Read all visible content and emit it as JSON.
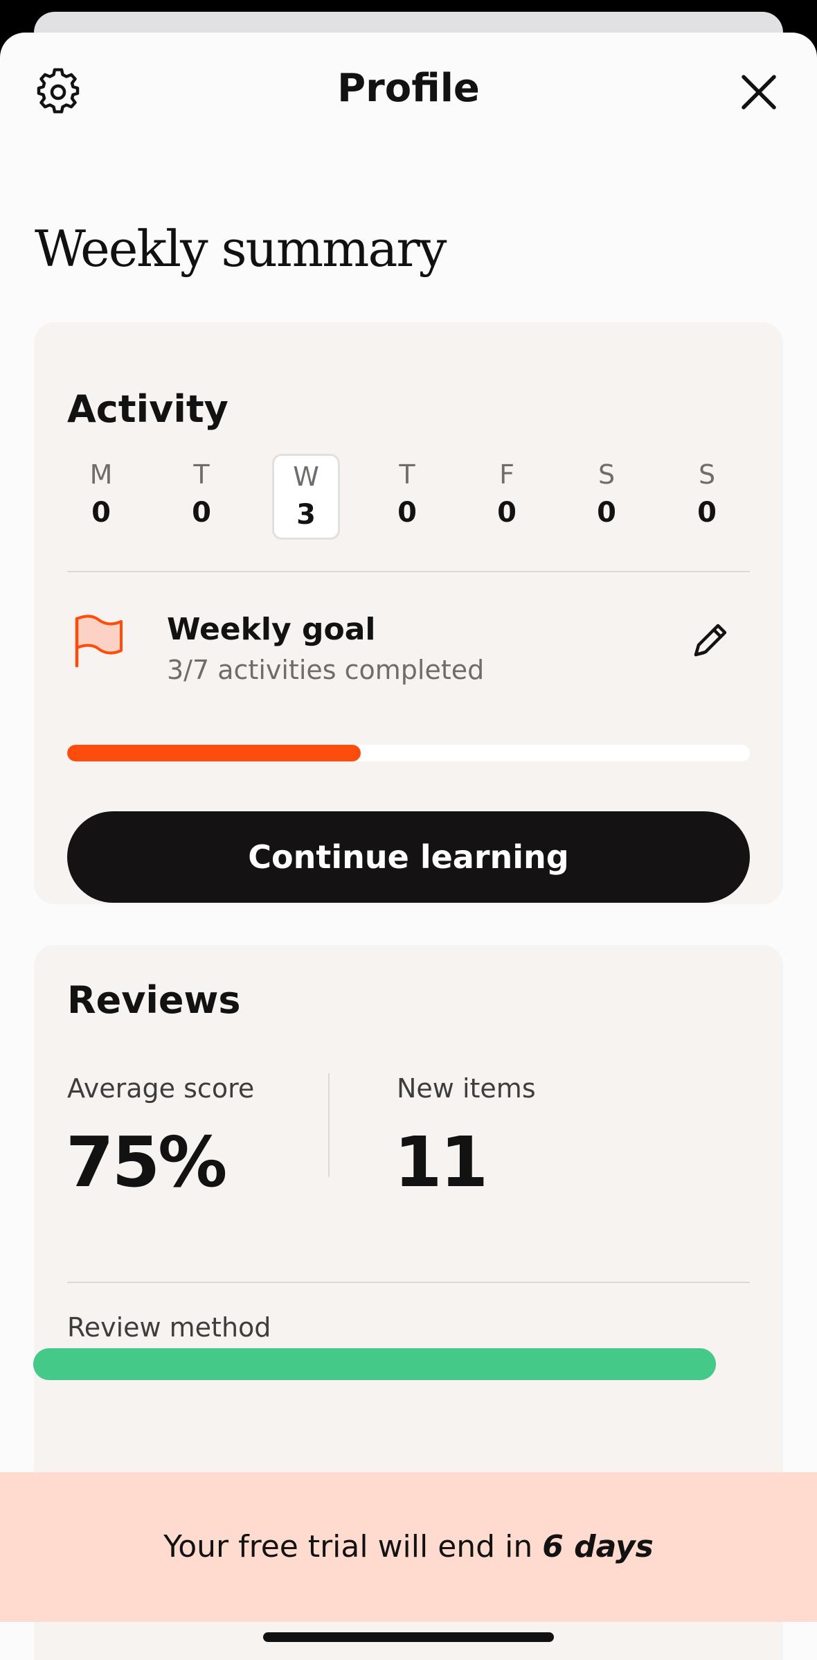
{
  "header": {
    "title": "Profile"
  },
  "weekly": {
    "title": "Weekly summary"
  },
  "activity": {
    "title": "Activity",
    "days": [
      {
        "letter": "M",
        "count": "0"
      },
      {
        "letter": "T",
        "count": "0"
      },
      {
        "letter": "W",
        "count": "3"
      },
      {
        "letter": "T",
        "count": "0"
      },
      {
        "letter": "F",
        "count": "0"
      },
      {
        "letter": "S",
        "count": "0"
      },
      {
        "letter": "S",
        "count": "0"
      }
    ],
    "goal_title": "Weekly goal",
    "goal_subtitle": "3/7 activities completed",
    "goal_progress": 0.43,
    "continue_label": "Continue learning"
  },
  "reviews": {
    "title": "Reviews",
    "average_label": "Average score",
    "average_value": "75%",
    "new_label": "New items",
    "new_value": "11",
    "method_label": "Review method"
  },
  "trial": {
    "prefix": "Your free trial will end in ",
    "emphasis": "6 days"
  },
  "colors": {
    "accent_orange": "#fd4c0c",
    "flag_fill": "#fbd2c3",
    "review_green": "#45c988",
    "banner_bg": "#fedbce"
  },
  "icons": {
    "settings": "gear-icon",
    "close": "close-icon",
    "goal": "flag-icon",
    "edit": "pencil-icon"
  }
}
